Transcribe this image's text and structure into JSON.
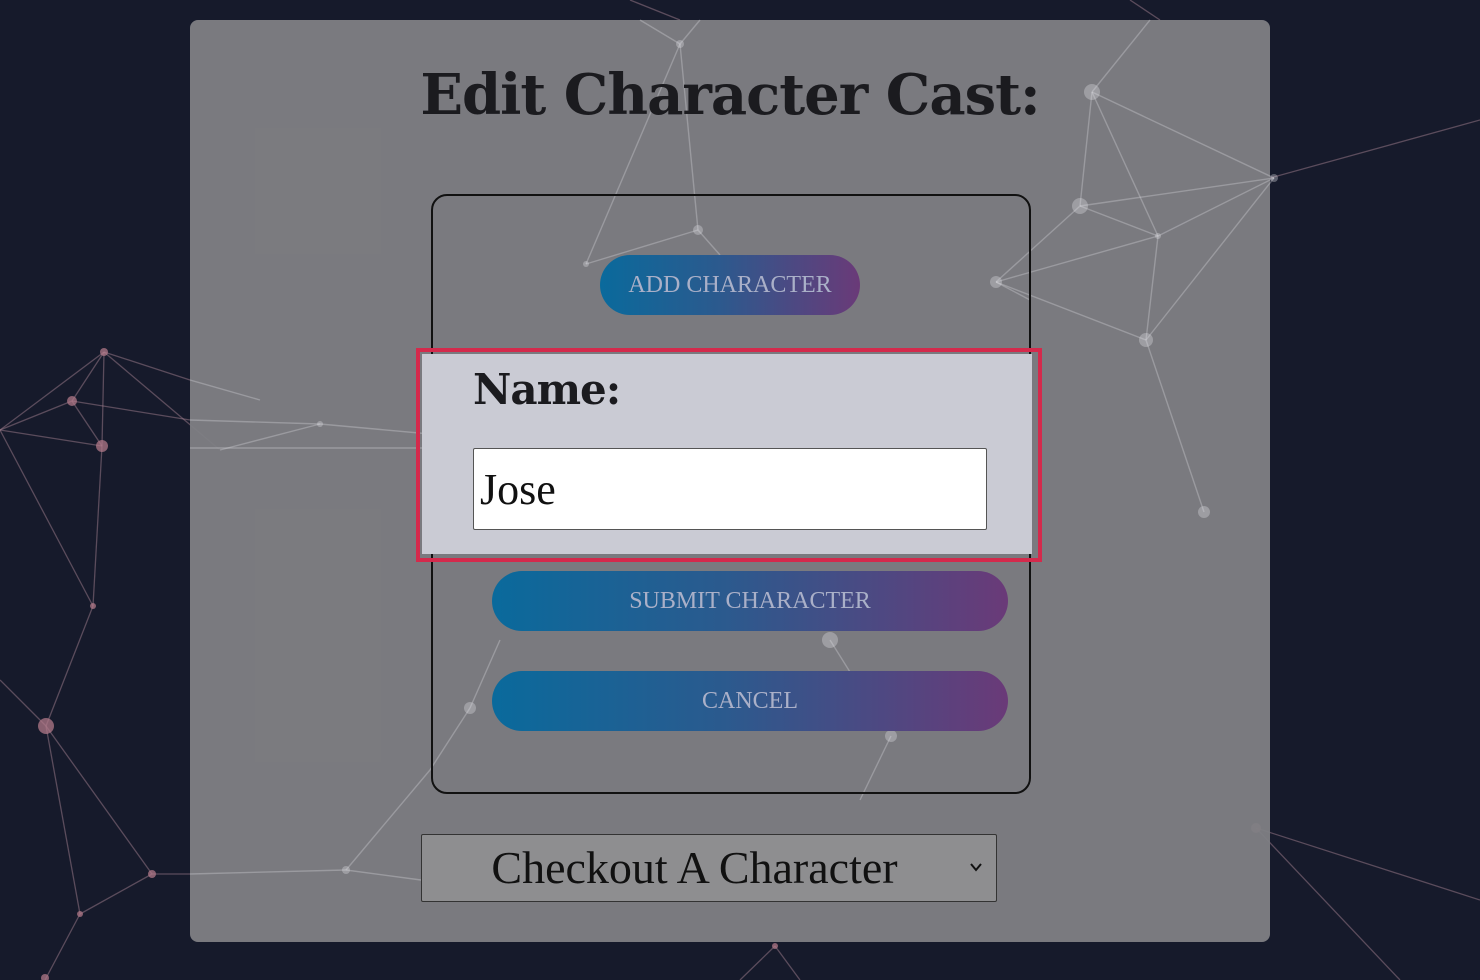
{
  "page": {
    "title": "Edit Character Cast:"
  },
  "form": {
    "add_character_label": "ADD CHARACTER",
    "name_label": "Name:",
    "name_value": "Jose",
    "submit_label": "SUBMIT CHARACTER",
    "cancel_label": "CANCEL"
  },
  "checkout": {
    "selected": "Checkout A Character",
    "icon": "chevron-down-icon"
  },
  "colors": {
    "background": "#161a2b",
    "panel": "#808084",
    "highlight": "#d42a4c",
    "button_gradient_start": "#0a6a9c",
    "button_gradient_end": "#6a3a78",
    "button_text": "#aab0c8"
  }
}
